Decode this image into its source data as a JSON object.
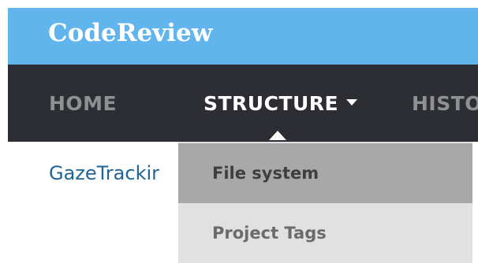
{
  "header": {
    "brand": "CodeReview"
  },
  "nav": {
    "items": [
      {
        "label": "HOME",
        "active": false
      },
      {
        "label": "STRUCTURE",
        "active": true,
        "has_dropdown": true
      },
      {
        "label": "HISTO",
        "active": false
      }
    ],
    "dropdown_icon": "caret-down-icon"
  },
  "dropdown": {
    "items": [
      {
        "label": "File system",
        "highlighted": true
      },
      {
        "label": "Project Tags",
        "highlighted": false
      }
    ]
  },
  "content": {
    "link_text": "GazeTrackir"
  },
  "colors": {
    "header_bg": "#62b5ec",
    "nav_bg": "#2d2e33",
    "nav_inactive_text": "#8f9094",
    "nav_active_text": "#ffffff",
    "link": "#1f6496",
    "dropdown_bg": "#e1e1e1",
    "dropdown_highlight": "#a8a8a8"
  }
}
